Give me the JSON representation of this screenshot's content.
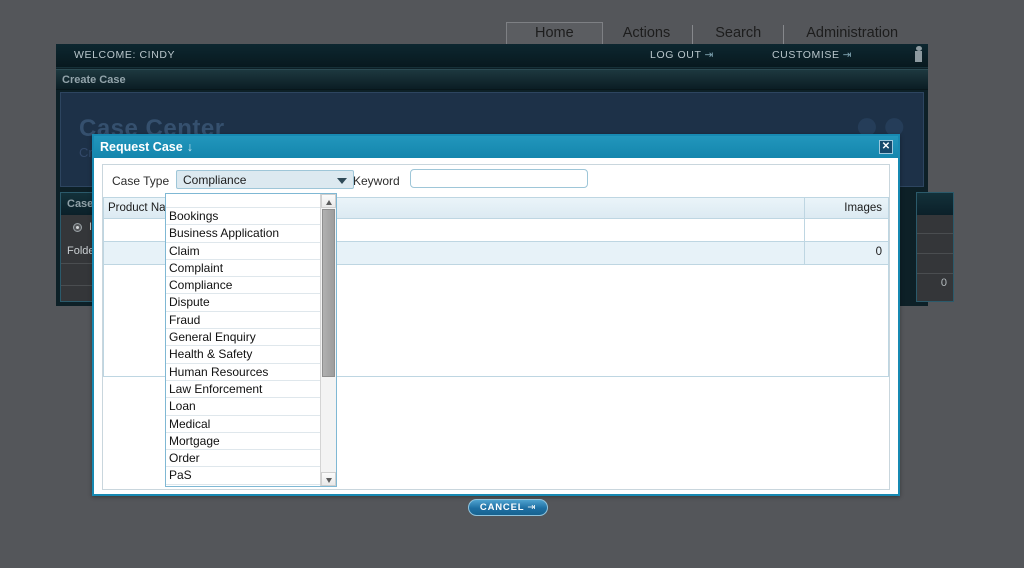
{
  "topnav": {
    "items": [
      {
        "label": "Home",
        "active": true
      },
      {
        "label": "Actions",
        "active": false
      },
      {
        "label": "Search",
        "active": false
      },
      {
        "label": "Administration",
        "active": false
      }
    ]
  },
  "appwindow": {
    "welcome": "WELCOME: CINDY",
    "logout": "LOG OUT",
    "customise": "CUSTOMISE",
    "arrow_glyph": "⇥",
    "page_title": "Create Case",
    "hero": {
      "title": "Case Center",
      "subtitle": "Cr",
      "watermark": "●●"
    },
    "left_panel": {
      "header": "Case",
      "radio_label": "I",
      "folder_label": "Folde"
    },
    "right_panel": {
      "count": "0"
    }
  },
  "modal": {
    "title": "Request Case",
    "title_icon": "↓",
    "close_label": "✕",
    "filters": {
      "case_type_label": "Case Type",
      "case_type_value": "Compliance",
      "keyword_label": "Keyword",
      "keyword_value": "",
      "keyword_placeholder": ""
    },
    "table": {
      "columns": [
        "Product Nam",
        "Images"
      ],
      "rows": [
        {
          "product_name": "",
          "images": ""
        },
        {
          "product_name": "",
          "images": "0"
        }
      ]
    },
    "cancel_label": "CANCEL",
    "cancel_arrow": "⇥"
  },
  "dropdown": {
    "open": true,
    "selected": "Compliance",
    "options": [
      "Bookings",
      "Business Application",
      "Claim",
      "Complaint",
      "Compliance",
      "Dispute",
      "Fraud",
      "General Enquiry",
      "Health & Safety",
      "Human Resources",
      "Law Enforcement",
      "Loan",
      "Medical",
      "Mortgage",
      "Order",
      "PaS"
    ]
  },
  "colors": {
    "desktop": "#54565a",
    "app_dark": "#0d2027",
    "hero_blue": "#1d3148",
    "modal_accent": "#1789b2",
    "title_bar": "#2296bc",
    "table_header": "#eaf4f9",
    "row_alt": "#e7f2f8",
    "button_blue": "#1e6fa3"
  }
}
